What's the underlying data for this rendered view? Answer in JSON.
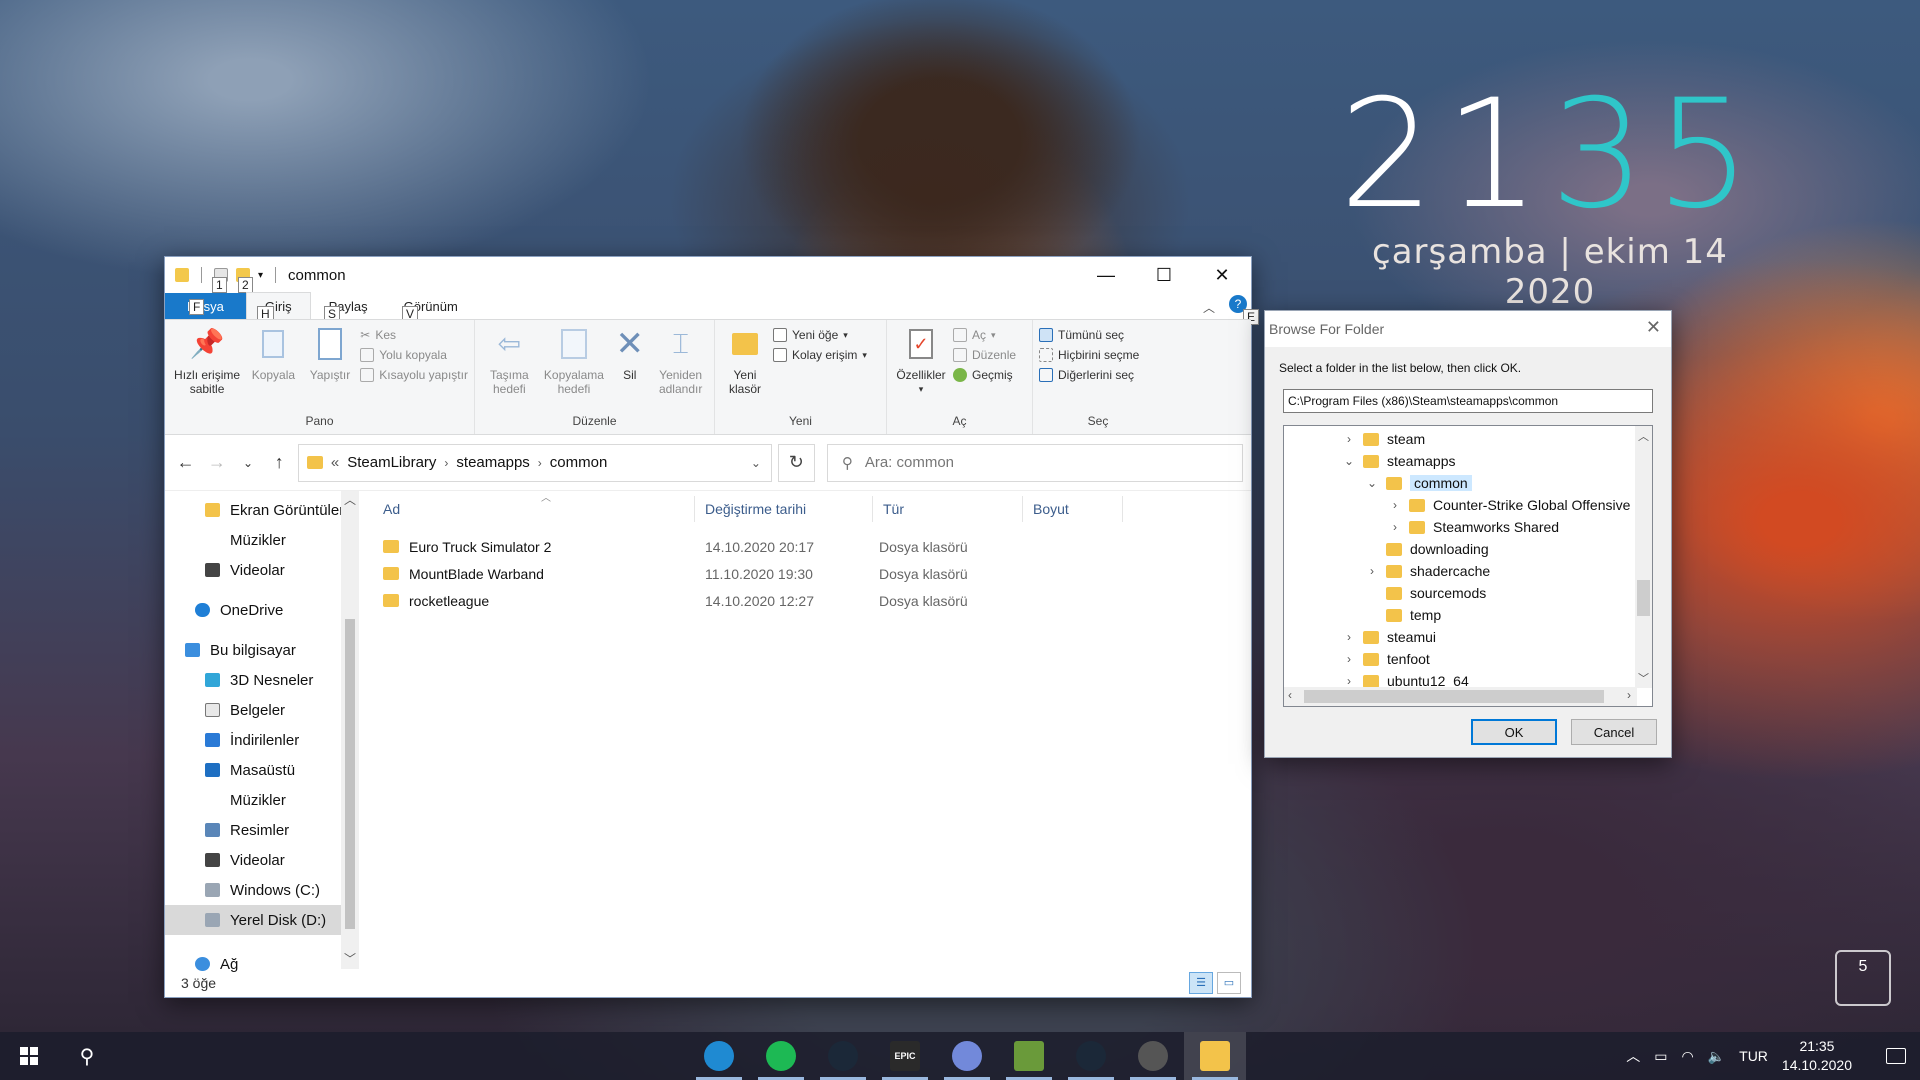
{
  "desktop": {
    "clock_hour": "21",
    "clock_minute": "35",
    "date_text": "çarşamba | ekim 14 2020",
    "bin_badge": "5"
  },
  "explorer": {
    "title": "common",
    "keytips": {
      "qa1": "1",
      "qa2": "2",
      "file": "F",
      "home": "H",
      "share": "S",
      "view": "V",
      "help": "E"
    },
    "tabs": {
      "file": "Dosya",
      "home": "Giriş",
      "share": "Paylaş",
      "view": "Görünüm"
    },
    "ribbon": {
      "pano": {
        "label": "Pano",
        "pin": "Hızlı erişime sabitle",
        "copy": "Kopyala",
        "paste": "Yapıştır",
        "cut": "Kes",
        "copy_path": "Yolu kopyala",
        "paste_shortcut": "Kısayolu yapıştır"
      },
      "duzenle": {
        "label": "Düzenle",
        "move_to": "Taşıma hedefi",
        "copy_to": "Kopyalama hedefi",
        "delete": "Sil",
        "rename": "Yeniden adlandır"
      },
      "yeni": {
        "label": "Yeni",
        "new_folder": "Yeni klasör",
        "new_item": "Yeni öğe",
        "easy_access": "Kolay erişim"
      },
      "ac": {
        "label": "Aç",
        "properties": "Özellikler",
        "open": "Aç",
        "edit": "Düzenle",
        "history": "Geçmiş"
      },
      "sec": {
        "label": "Seç",
        "select_all": "Tümünü seç",
        "select_none": "Hiçbirini seçme",
        "invert": "Diğerlerini seç"
      }
    },
    "address": {
      "prefix": "«",
      "crumbs": [
        "SteamLibrary",
        "steamapps",
        "common"
      ]
    },
    "search_placeholder": "Ara: common",
    "nav": [
      {
        "label": "Ekran Görüntüleri",
        "icon": "folder-icon"
      },
      {
        "label": "Müzikler",
        "icon": "music-icon"
      },
      {
        "label": "Videolar",
        "icon": "video-icon"
      },
      {
        "label": "OneDrive",
        "icon": "cloud-icon"
      },
      {
        "label": "Bu bilgisayar",
        "icon": "computer-icon"
      },
      {
        "label": "3D Nesneler",
        "icon": "cube-icon"
      },
      {
        "label": "Belgeler",
        "icon": "document-icon"
      },
      {
        "label": "İndirilenler",
        "icon": "download-icon"
      },
      {
        "label": "Masaüstü",
        "icon": "desktop-icon"
      },
      {
        "label": "Müzikler",
        "icon": "music-icon"
      },
      {
        "label": "Resimler",
        "icon": "picture-icon"
      },
      {
        "label": "Videolar",
        "icon": "video-icon"
      },
      {
        "label": "Windows (C:)",
        "icon": "drive-icon"
      },
      {
        "label": "Yerel Disk (D:)",
        "icon": "drive-icon"
      },
      {
        "label": "Ağ",
        "icon": "network-icon"
      }
    ],
    "columns": {
      "name": "Ad",
      "modified": "Değiştirme tarihi",
      "type": "Tür",
      "size": "Boyut"
    },
    "files": [
      {
        "name": "Euro Truck Simulator 2",
        "modified": "14.10.2020 20:17",
        "type": "Dosya klasörü"
      },
      {
        "name": "MountBlade Warband",
        "modified": "11.10.2020 19:30",
        "type": "Dosya klasörü"
      },
      {
        "name": "rocketleague",
        "modified": "14.10.2020 12:27",
        "type": "Dosya klasörü"
      }
    ],
    "status": "3 öğe"
  },
  "dialog": {
    "title": "Browse For Folder",
    "instruction": "Select a folder in the list below, then click OK.",
    "path": "C:\\Program Files (x86)\\Steam\\steamapps\\common",
    "tree": [
      {
        "label": "steam",
        "expander": "›"
      },
      {
        "label": "steamapps",
        "expander": "⌄"
      },
      {
        "label": "common",
        "expander": "⌄"
      },
      {
        "label": "Counter-Strike Global Offensive",
        "expander": "›"
      },
      {
        "label": "Steamworks Shared",
        "expander": "›"
      },
      {
        "label": "downloading",
        "expander": ""
      },
      {
        "label": "shadercache",
        "expander": "›"
      },
      {
        "label": "sourcemods",
        "expander": ""
      },
      {
        "label": "temp",
        "expander": ""
      },
      {
        "label": "steamui",
        "expander": "›"
      },
      {
        "label": "tenfoot",
        "expander": "›"
      },
      {
        "label": "ubuntu12_64",
        "expander": "›"
      }
    ],
    "ok": "OK",
    "cancel": "Cancel"
  },
  "taskbar": {
    "apps": [
      {
        "name": "edge-icon",
        "color": "#1f8ad2",
        "text": ""
      },
      {
        "name": "spotify-icon",
        "color": "#1db954",
        "text": ""
      },
      {
        "name": "steam-icon",
        "color": "#1b2838",
        "text": ""
      },
      {
        "name": "epic-games-icon",
        "color": "#2a2a2a",
        "text": "EPIC"
      },
      {
        "name": "discord-icon",
        "color": "#7289da",
        "text": ""
      },
      {
        "name": "minecraft-icon",
        "color": "#6a9a3a",
        "text": ""
      },
      {
        "name": "steam-icon-2",
        "color": "#1b2838",
        "text": ""
      },
      {
        "name": "settings-icon",
        "color": "#555555",
        "text": ""
      },
      {
        "name": "file-explorer-icon",
        "color": "#f3c34a",
        "text": ""
      }
    ],
    "lang": "TUR",
    "time": "21:35",
    "date": "14.10.2020"
  }
}
